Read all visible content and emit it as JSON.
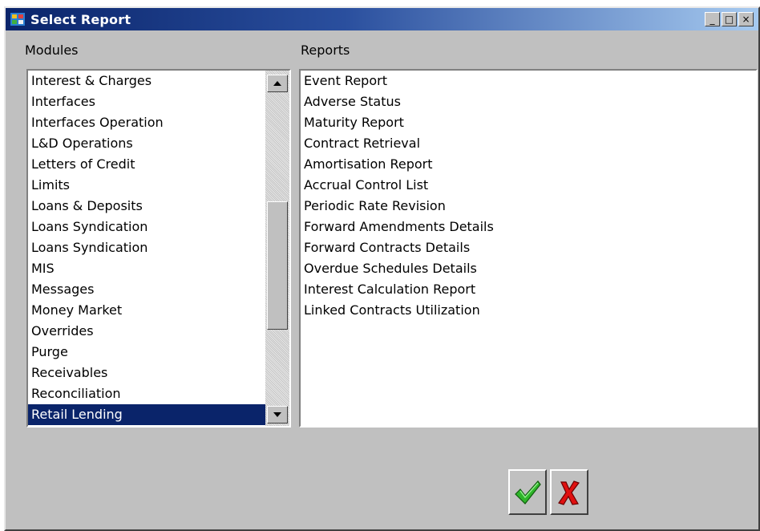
{
  "window": {
    "title": "Select Report",
    "controls": {
      "minimize": "_",
      "maximize": "□",
      "close": "×"
    }
  },
  "modules": {
    "label": "Modules",
    "items": [
      "Interest & Charges",
      "Interfaces",
      "Interfaces Operation",
      "L&D Operations",
      "Letters of Credit",
      "Limits",
      "Loans & Deposits",
      "Loans Syndication",
      "Loans Syndication",
      "MIS",
      "Messages",
      "Money Market",
      "Overrides",
      "Purge",
      "Receivables",
      "Reconciliation",
      "Retail Lending"
    ],
    "selected": "Retail Lending"
  },
  "reports": {
    "label": "Reports",
    "items": [
      "Event Report",
      "Adverse Status",
      "Maturity Report",
      "Contract Retrieval",
      "Amortisation Report",
      "Accrual Control List",
      "Periodic Rate Revision",
      "Forward Amendments Details",
      "Forward Contracts  Details",
      "Overdue Schedules  Details",
      "Interest Calculation Report",
      "Linked Contracts  Utilization"
    ]
  },
  "buttons": {
    "ok_icon": "checkmark-icon",
    "cancel_icon": "x-icon"
  },
  "colors": {
    "titlebar": "#0a246a",
    "selection": "#0a246a",
    "ok_green": "#2fb52a",
    "cancel_red": "#e01010"
  }
}
